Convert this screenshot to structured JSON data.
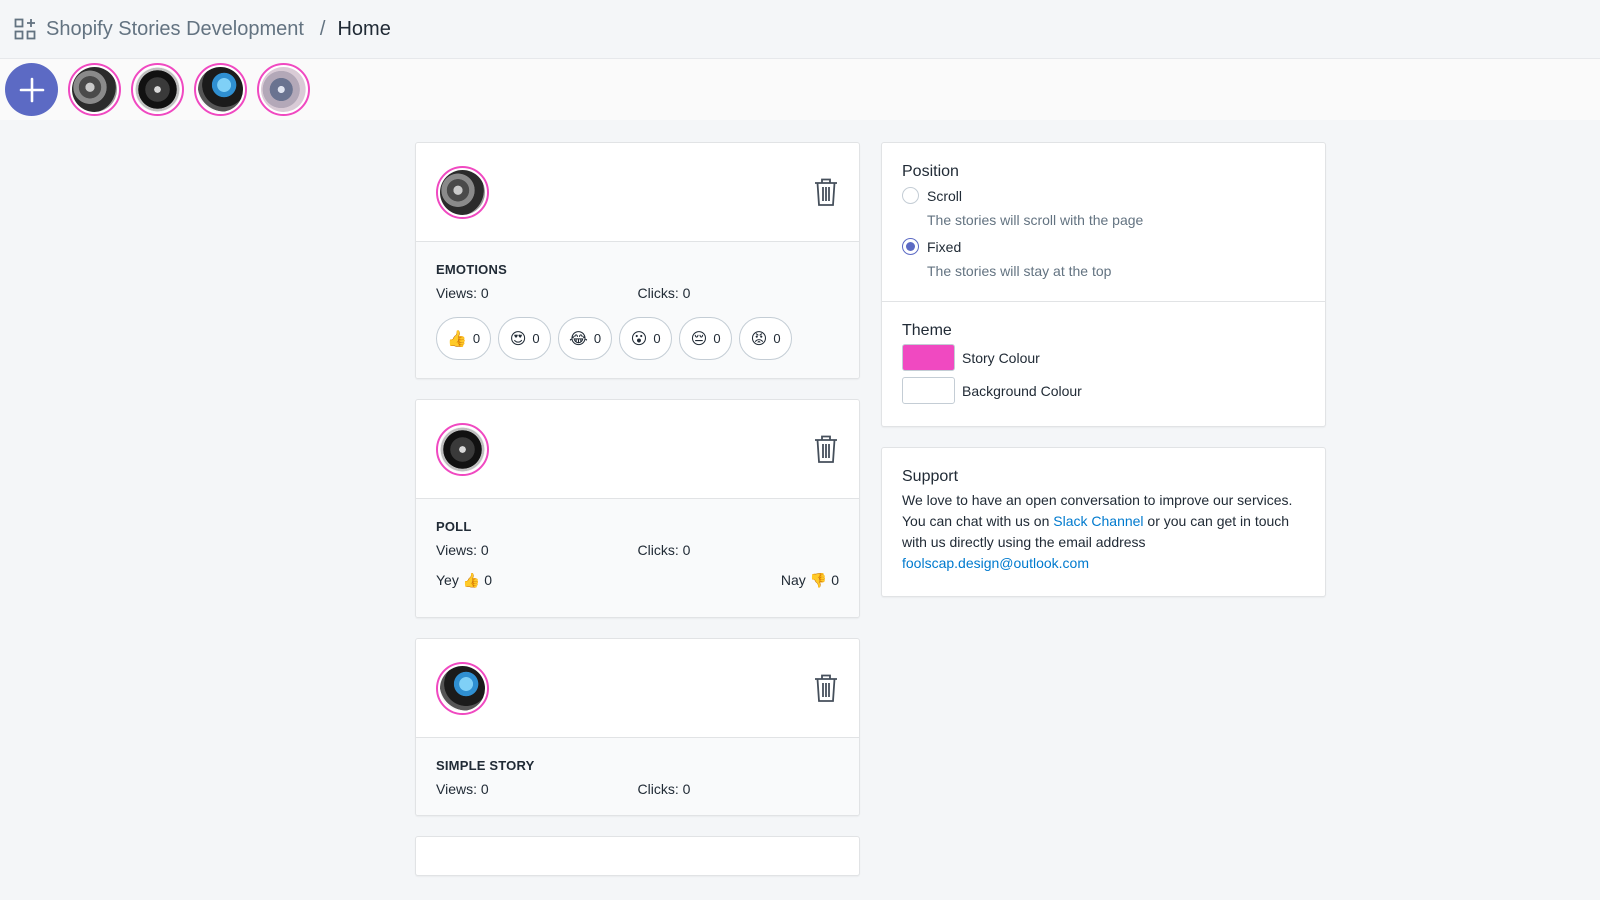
{
  "breadcrumb": {
    "app": "Shopify Stories Development",
    "separator": "/",
    "page": "Home"
  },
  "colors": {
    "accent": "#5c6ac4",
    "story": "#f049c1",
    "background": "#ffffff",
    "link": "#007ace"
  },
  "story_bar": {
    "add_icon": "plus-icon",
    "thumbnails": [
      "watch-1",
      "watch-2",
      "watch-3",
      "watch-4"
    ]
  },
  "stories": [
    {
      "type": "EMOTIONS",
      "views_label": "Views:",
      "views": "0",
      "clicks_label": "Clicks:",
      "clicks": "0",
      "reactions": [
        {
          "emoji": "👍",
          "count": "0"
        },
        {
          "emoji": "😍",
          "count": "0"
        },
        {
          "emoji": "😂",
          "count": "0"
        },
        {
          "emoji": "😮",
          "count": "0"
        },
        {
          "emoji": "😔",
          "count": "0"
        },
        {
          "emoji": "😡",
          "count": "0"
        }
      ]
    },
    {
      "type": "POLL",
      "views_label": "Views:",
      "views": "0",
      "clicks_label": "Clicks:",
      "clicks": "0",
      "yey_label": "Yey",
      "yey_count": "0",
      "nay_label": "Nay",
      "nay_count": "0"
    },
    {
      "type": "SIMPLE STORY",
      "views_label": "Views:",
      "views": "0",
      "clicks_label": "Clicks:",
      "clicks": "0"
    }
  ],
  "settings": {
    "position": {
      "title": "Position",
      "options": [
        {
          "label": "Scroll",
          "help": "The stories will scroll with the page",
          "selected": false
        },
        {
          "label": "Fixed",
          "help": "The stories will stay at the top",
          "selected": true
        }
      ]
    },
    "theme": {
      "title": "Theme",
      "story_colour_label": "Story Colour",
      "background_colour_label": "Background Colour"
    }
  },
  "support": {
    "title": "Support",
    "text_1": "We love to have an open conversation to improve our services. You can chat with us on ",
    "slack_link": "Slack Channel",
    "text_2": " or you can get in touch with us directly using the email address ",
    "email": "foolscap.design@outlook.com"
  }
}
